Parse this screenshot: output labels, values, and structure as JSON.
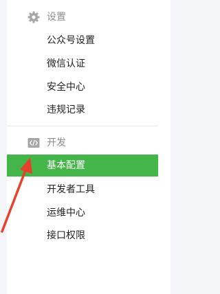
{
  "sidebar": {
    "sections": [
      {
        "title": "设置",
        "icon": "gear-icon",
        "items": [
          {
            "label": "公众号设置",
            "active": false
          },
          {
            "label": "微信认证",
            "active": false
          },
          {
            "label": "安全中心",
            "active": false
          },
          {
            "label": "违规记录",
            "active": false
          }
        ]
      },
      {
        "title": "开发",
        "icon": "code-icon",
        "items": [
          {
            "label": "基本配置",
            "active": true
          },
          {
            "label": "开发者工具",
            "active": false
          },
          {
            "label": "运维中心",
            "active": false
          },
          {
            "label": "接口权限",
            "active": false
          }
        ]
      }
    ]
  },
  "colors": {
    "active_bg": "#44b549",
    "annotation_arrow": "#e8402a",
    "section_icon": "#a6a6a6"
  }
}
